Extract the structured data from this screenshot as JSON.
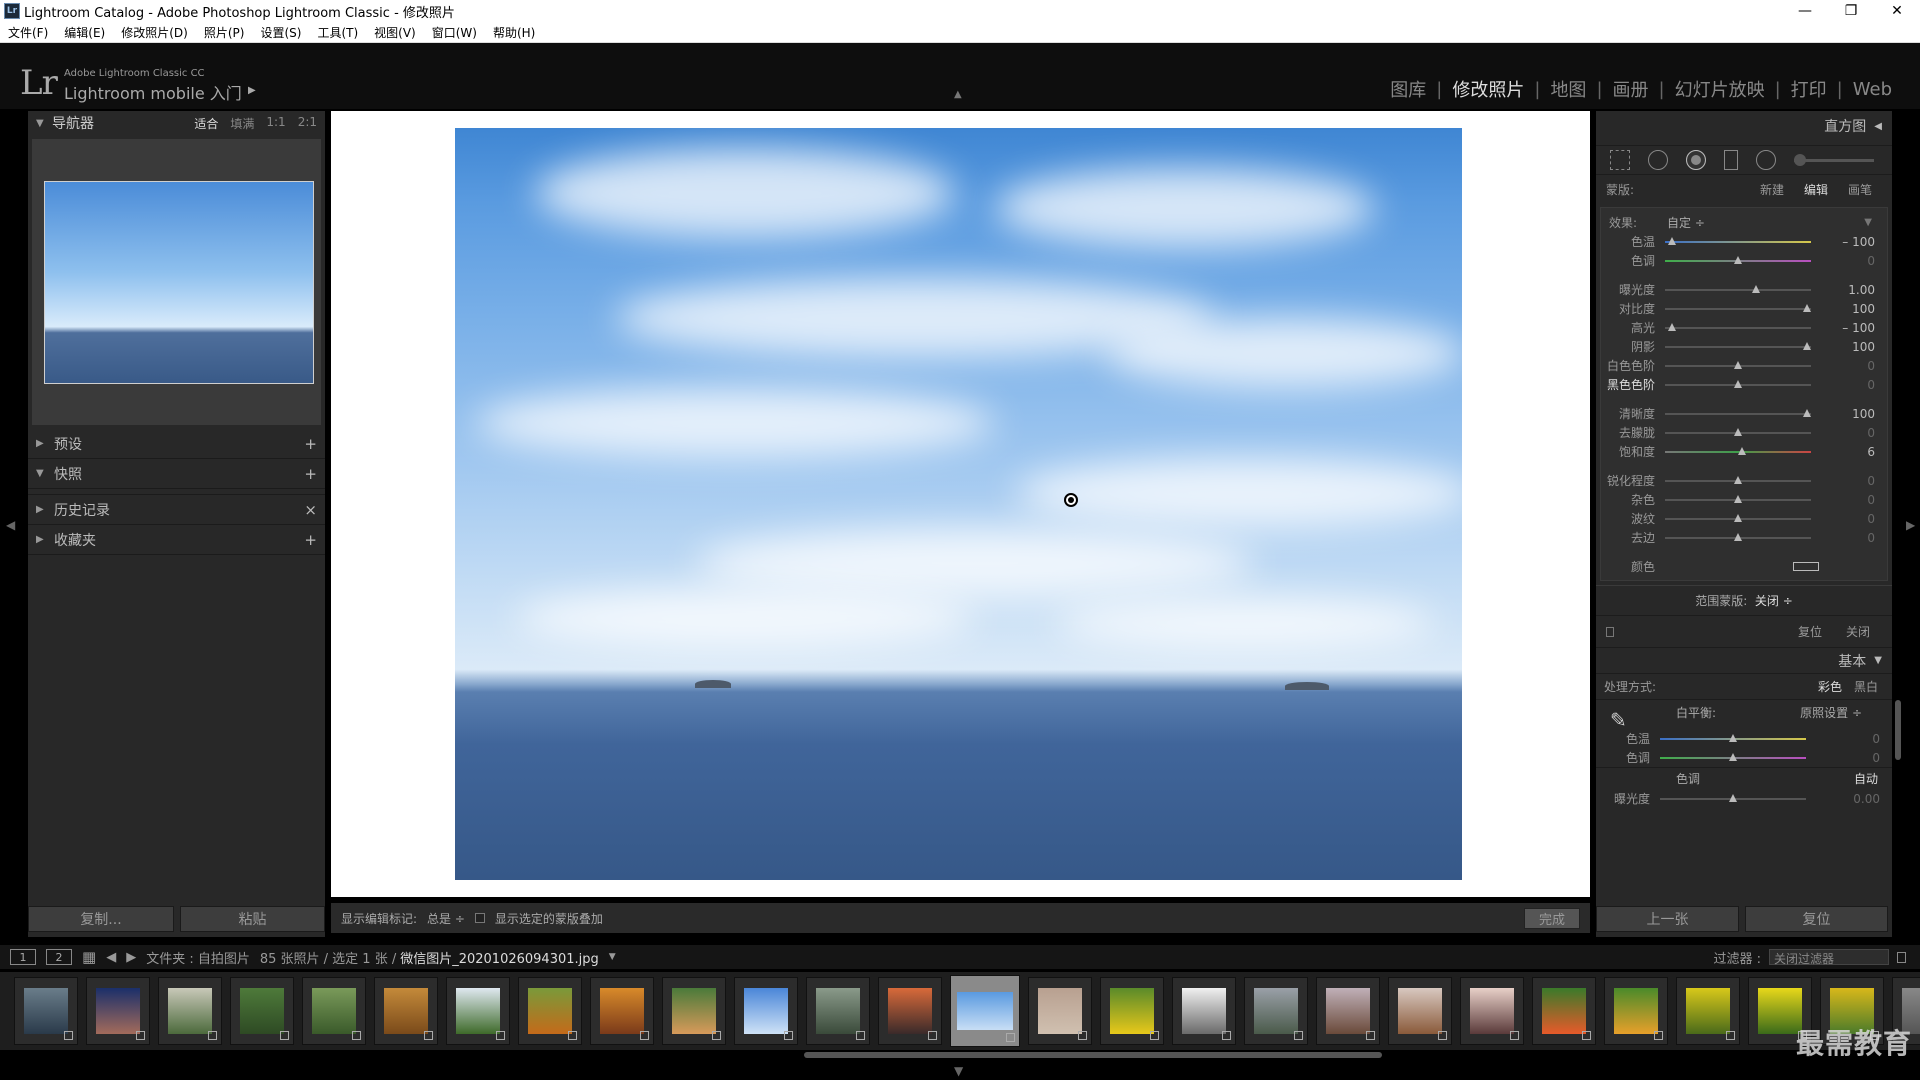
{
  "window": {
    "title": "Lightroom Catalog - Adobe Photoshop Lightroom Classic - 修改照片",
    "app_icon": "Lr"
  },
  "menu": [
    "文件(F)",
    "编辑(E)",
    "修改照片(D)",
    "照片(P)",
    "设置(S)",
    "工具(T)",
    "视图(V)",
    "窗口(W)",
    "帮助(H)"
  ],
  "brand": {
    "logo": "Lr",
    "small": "Adobe Lightroom Classic CC",
    "big": "Lightroom mobile 入门",
    "arrow": "▶"
  },
  "modules": [
    {
      "label": "图库",
      "active": false
    },
    {
      "label": "修改照片",
      "active": true
    },
    {
      "label": "地图",
      "active": false
    },
    {
      "label": "画册",
      "active": false
    },
    {
      "label": "幻灯片放映",
      "active": false
    },
    {
      "label": "打印",
      "active": false
    },
    {
      "label": "Web",
      "active": false
    }
  ],
  "navigator": {
    "title": "导航器",
    "options": [
      "适合",
      "填满",
      "1:1",
      "2:1"
    ]
  },
  "left_sections": [
    {
      "label": "预设",
      "action": "+"
    },
    {
      "label": "快照",
      "action": "+"
    },
    {
      "label": "历史记录",
      "action": "×"
    },
    {
      "label": "收藏夹",
      "action": "+"
    }
  ],
  "left_buttons": {
    "copy": "复制...",
    "paste": "粘贴"
  },
  "toolbar": {
    "show_label": "显示编辑标记:",
    "show_value": "总是 ÷",
    "overlay_label": "显示选定的蒙版叠加",
    "done": "完成"
  },
  "right": {
    "histogram": "直方图",
    "mask_label": "蒙版:",
    "mask_opts": [
      "新建",
      "编辑",
      "画笔"
    ],
    "effect_label": "效果:",
    "effect_value": "自定 ÷",
    "sliders_group1": [
      {
        "label": "色温",
        "pos": 0.05,
        "value": "– 100"
      },
      {
        "label": "色调",
        "pos": 0.5,
        "value": "0"
      }
    ],
    "sliders_group2": [
      {
        "label": "曝光度",
        "pos": 0.62,
        "value": "1.00"
      },
      {
        "label": "对比度",
        "pos": 0.97,
        "value": "100"
      },
      {
        "label": "高光",
        "pos": 0.05,
        "value": "– 100"
      },
      {
        "label": "阴影",
        "pos": 0.97,
        "value": "100"
      },
      {
        "label": "白色色阶",
        "pos": 0.5,
        "value": "0"
      },
      {
        "label": "黑色色阶",
        "pos": 0.5,
        "value": "0"
      }
    ],
    "sliders_group3": [
      {
        "label": "清晰度",
        "pos": 0.97,
        "value": "100"
      },
      {
        "label": "去朦胧",
        "pos": 0.5,
        "value": "0"
      },
      {
        "label": "饱和度",
        "pos": 0.53,
        "value": "6"
      }
    ],
    "sliders_group4": [
      {
        "label": "锐化程度",
        "pos": 0.5,
        "value": "0"
      },
      {
        "label": "杂色",
        "pos": 0.5,
        "value": "0"
      },
      {
        "label": "波纹",
        "pos": 0.5,
        "value": "0"
      },
      {
        "label": "去边",
        "pos": 0.5,
        "value": "0"
      }
    ],
    "color_label": "颜色",
    "range_label": "范围蒙版:",
    "range_value": "关闭 ÷",
    "reset": "复位",
    "close": "关闭",
    "basic": "基本",
    "process_label": "处理方式:",
    "process_opts": [
      "彩色",
      "黑白"
    ],
    "wb_label": "白平衡:",
    "wb_value": "原照设置 ÷",
    "wb_sliders": [
      {
        "label": "色温",
        "pos": 0.5,
        "value": "0"
      },
      {
        "label": "色调",
        "pos": 0.5,
        "value": "0"
      }
    ],
    "tone_label": "色调",
    "tone_auto": "自动",
    "exposure": {
      "label": "曝光度",
      "pos": 0.5,
      "value": "0.00"
    }
  },
  "right_buttons": {
    "prev": "上一张",
    "reset": "复位"
  },
  "filmbar": {
    "view1": "1",
    "view2": "2",
    "folder": "文件夹 : 自拍图片",
    "count": "85 张照片 / 选定 1 张 /",
    "filename": "微信图片_20201026094301.jpg",
    "filter_label": "过滤器 :",
    "filter_value": "关闭过滤器"
  },
  "watermark": "最需教育"
}
